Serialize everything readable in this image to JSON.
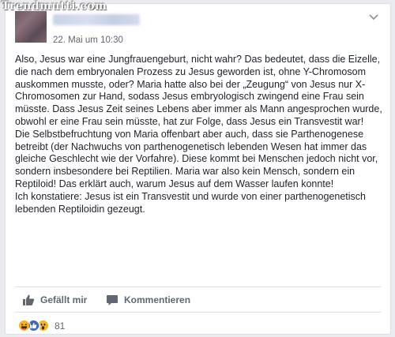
{
  "watermark": "Trendmutti.com",
  "post": {
    "timestamp": "22. Mai um 10:30",
    "paragraphs": [
      "Also, Jesus war eine Jungfrauengeburt, nicht wahr? Das bedeutet, dass die Eizelle, die nach dem embryonalen Prozess zu Jesus geworden ist, ohne Y-Chromosom auskommen musste, oder? Maria hatte also bei der „Zeugung“ von Jesus nur X-Chromosomen zur Hand, sodass Jesus embryologisch zwingend eine Frau sein müsste. Dass Jesus Zeit seines Lebens aber immer als Mann angesprochen wurde, obwohl er eine Frau sein müsste, hat zur Folge, dass Jesus ein Transvestit war!",
      "Die Selbstbefruchtung von Maria offenbart aber auch, dass sie Parthenogenese betreibt (der Nachwuchs von parthenogenetisch lebenden Wesen hat immer das gleiche Geschlecht wie der Vorfahre). Diese kommt bei Menschen jedoch nicht vor, sondern insbesondere bei Reptilien. Maria war also kein Mensch, sondern ein Reptiloid! Das erklärt auch, warum Jesus auf dem Wasser laufen konnte!",
      "Ich konstatiere: Jesus ist ein Transvestit und wurde von einer parthenogenetisch lebenden Reptiloidin gezeugt."
    ]
  },
  "actions": {
    "like_label": "Gefällt mir",
    "comment_label": "Kommentieren"
  },
  "reactions": {
    "types": [
      "haha",
      "like",
      "wow"
    ],
    "count": "81"
  },
  "colors": {
    "like_blue": "#4267b2",
    "reaction_yellow": "#f7b125",
    "text_gray": "#606770"
  }
}
